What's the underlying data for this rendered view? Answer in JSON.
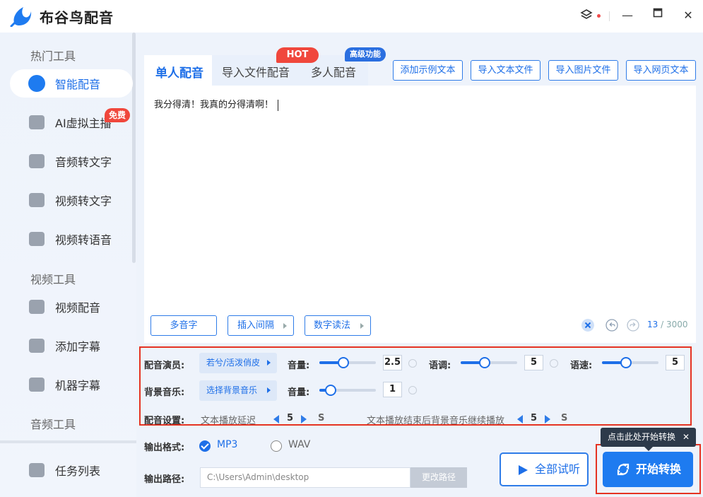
{
  "app": {
    "title": "布谷鸟配音"
  },
  "sidebar": {
    "sections": [
      "热门工具",
      "视频工具",
      "音频工具"
    ],
    "items": [
      {
        "label": "智能配音",
        "icon": "mic-icon"
      },
      {
        "label": "AI虚拟主播",
        "icon": "avatar-icon"
      },
      {
        "label": "音频转文字",
        "icon": "audio-text-icon"
      },
      {
        "label": "视频转文字",
        "icon": "video-text-icon"
      },
      {
        "label": "视频转语音",
        "icon": "video-audio-icon"
      },
      {
        "label": "视频配音",
        "icon": "video-dub-icon"
      },
      {
        "label": "添加字幕",
        "icon": "subtitle-icon"
      },
      {
        "label": "机器字幕",
        "icon": "robot-icon"
      },
      {
        "label": "任务列表",
        "icon": "task-list-icon"
      }
    ],
    "free_badge": "免费"
  },
  "tabs": [
    {
      "label": "单人配音"
    },
    {
      "label": "导入文件配音"
    },
    {
      "label": "多人配音"
    }
  ],
  "badges": {
    "hot": "HOT",
    "advanced": "高级功能"
  },
  "top_buttons": [
    "添加示例文本",
    "导入文本文件",
    "导入图片文件",
    "导入网页文本"
  ],
  "editor": {
    "text": "我分得清！我真的分得清啊！",
    "count": "13",
    "max": "/ 3000"
  },
  "tools": [
    "多音字",
    "插入间隔",
    "数字读法"
  ],
  "settings": {
    "actor_label": "配音演员:",
    "actor_value": "若兮/活泼俏皮",
    "volume_label": "音量:",
    "volume_value": "2.5",
    "pitch_label": "语调:",
    "pitch_value": "5",
    "speed_label": "语速:",
    "speed_value": "5",
    "bgm_label": "背景音乐:",
    "bgm_value": "选择背景音乐",
    "bgm_volume_label": "音量:",
    "bgm_volume_value": "1",
    "config_label": "配音设置:",
    "delay_label": "文本播放延迟",
    "delay_value": "5",
    "delay_unit": "S",
    "after_label": "文本播放结束后背景音乐继续播放",
    "after_value": "5",
    "after_unit": "S"
  },
  "output": {
    "format_label": "输出格式:",
    "format_options": [
      "MP3",
      "WAV"
    ],
    "selected_format": "MP3",
    "path_label": "输出路径:",
    "path_value": "C:\\Users\\Admin\\desktop",
    "change_path": "更改路径"
  },
  "actions": {
    "preview": "全部试听",
    "start": "开始转换",
    "tooltip": "点击此处开始转换"
  },
  "colors": {
    "accent": "#1e7bf0",
    "highlight": "#e53322",
    "badge": "#f0473c"
  }
}
